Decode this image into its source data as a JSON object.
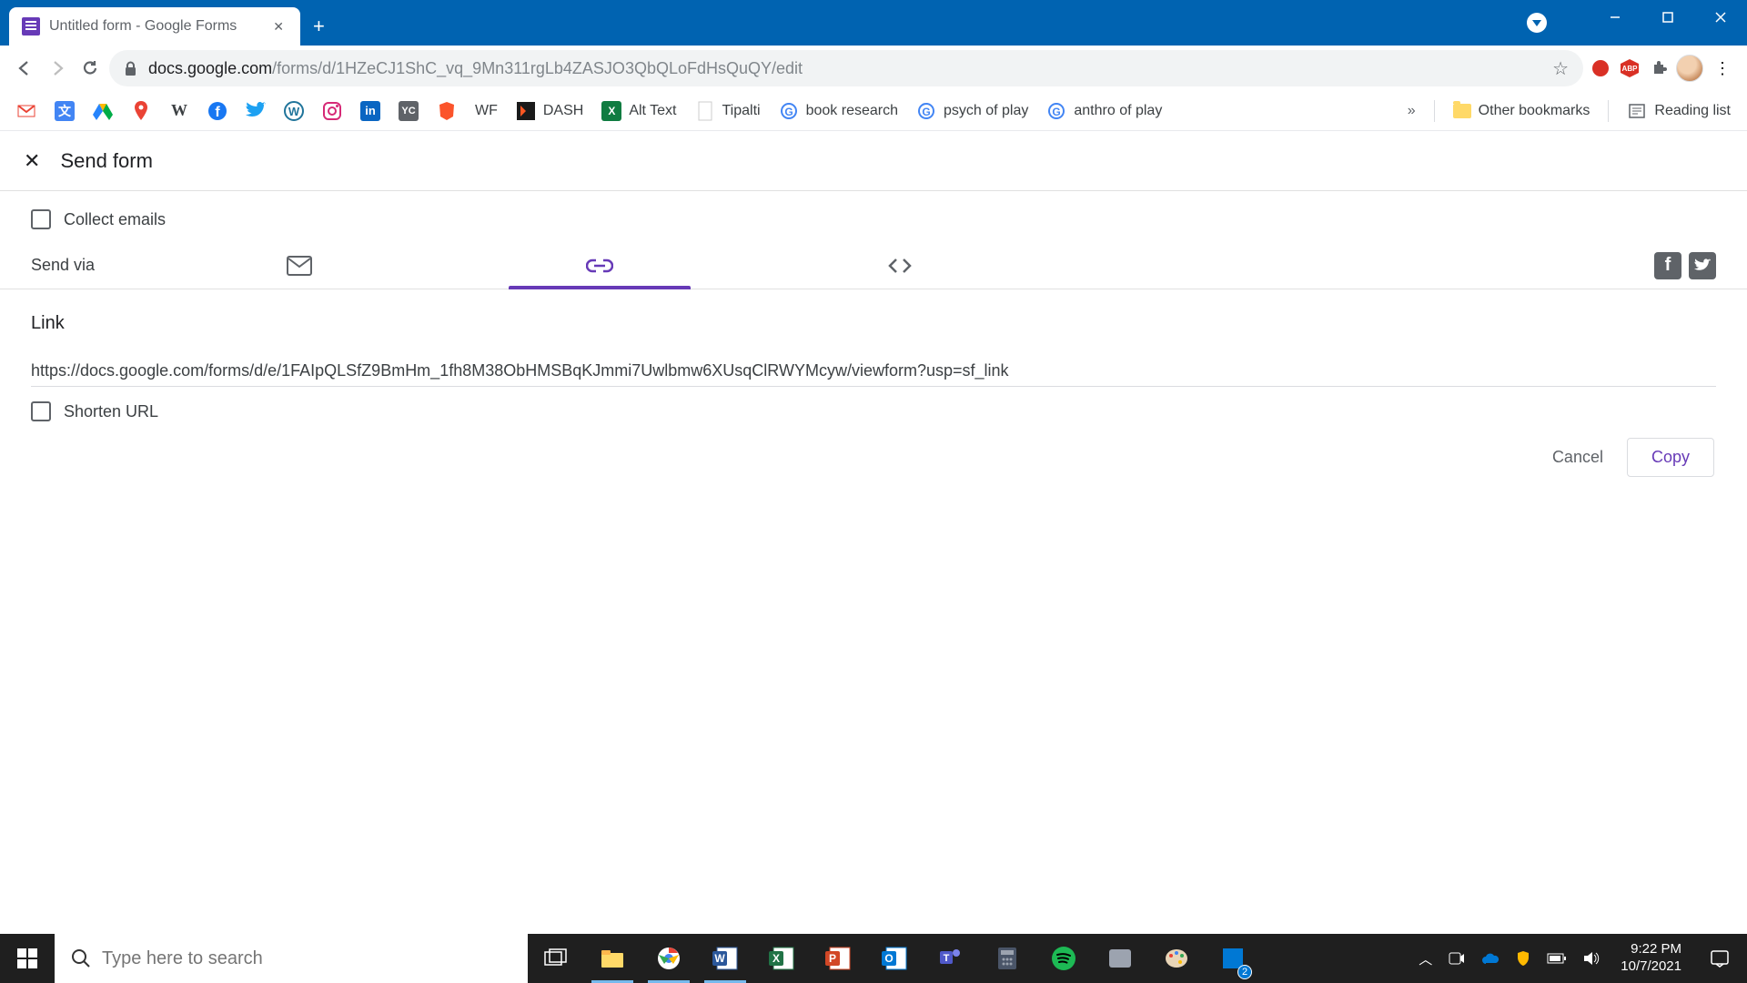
{
  "browser": {
    "tab_title": "Untitled form - Google Forms",
    "url_host": "docs.google.com",
    "url_path": "/forms/d/1HZeCJ1ShC_vq_9Mn311rgLb4ZASJO3QbQLoFdHsQuQY/edit"
  },
  "bookmarks": {
    "items": [
      "WF",
      "DASH",
      "Alt Text",
      "Tipalti",
      "book research",
      "psych of play",
      "anthro of play"
    ],
    "other": "Other bookmarks",
    "reading_list": "Reading list"
  },
  "send_form": {
    "title": "Send form",
    "collect_emails_label": "Collect emails",
    "send_via_label": "Send via",
    "link_heading": "Link",
    "link_value": "https://docs.google.com/forms/d/e/1FAIpQLSfZ9BmHm_1fh8M38ObHMSBqKJmmi7Uwlbmw6XUsqClRWYMcyw/viewform?usp=sf_link",
    "shorten_label": "Shorten URL",
    "cancel": "Cancel",
    "copy": "Copy"
  },
  "taskbar": {
    "search_placeholder": "Type here to search",
    "time": "9:22 PM",
    "date": "10/7/2021",
    "badge": "2"
  }
}
